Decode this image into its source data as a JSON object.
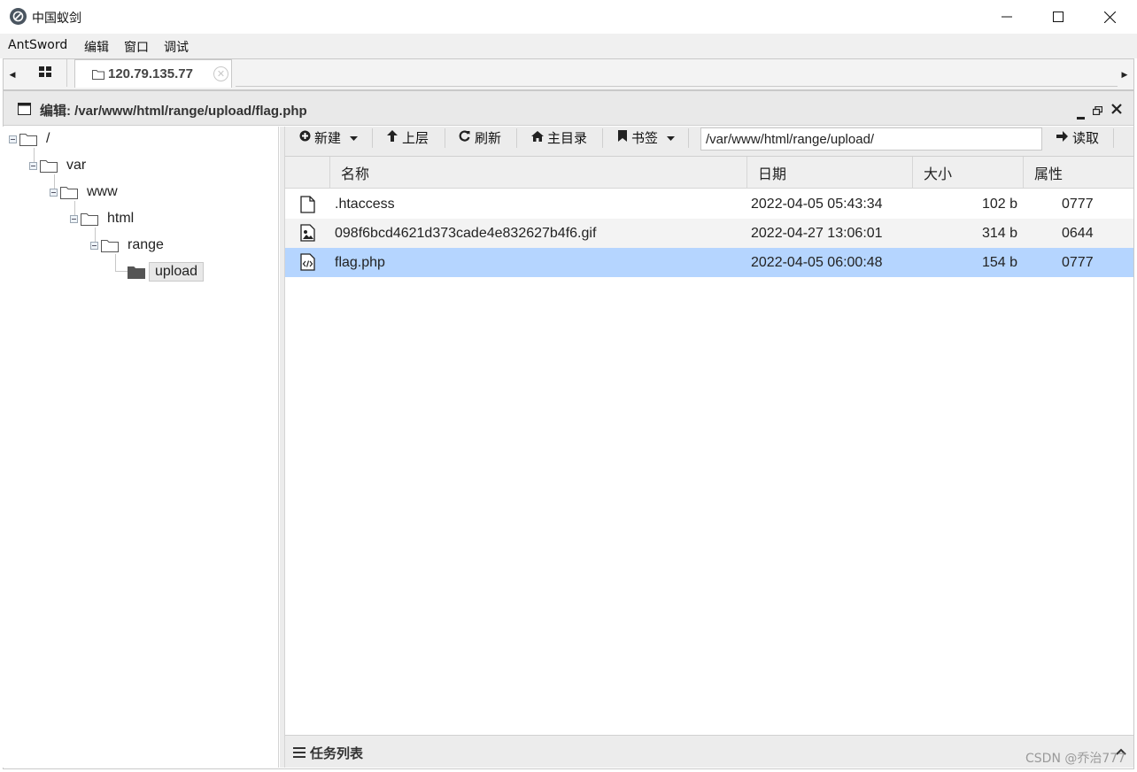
{
  "window": {
    "title": "中国蚁剑"
  },
  "menu": [
    "AntSword",
    "编辑",
    "窗口",
    "调试"
  ],
  "tabs": {
    "host_label": "120.79.135.77"
  },
  "panel": {
    "title": "编辑: /var/www/html/range/upload/flag.php"
  },
  "tree": [
    {
      "label": "/",
      "depth": 0,
      "expanded": true,
      "selected": false
    },
    {
      "label": "var",
      "depth": 1,
      "expanded": true,
      "selected": false
    },
    {
      "label": "www",
      "depth": 2,
      "expanded": true,
      "selected": false
    },
    {
      "label": "html",
      "depth": 3,
      "expanded": true,
      "selected": false
    },
    {
      "label": "range",
      "depth": 4,
      "expanded": true,
      "selected": false
    },
    {
      "label": "upload",
      "depth": 5,
      "expanded": false,
      "selected": true
    }
  ],
  "toolbar": {
    "new_label": "新建",
    "up_label": "上层",
    "refresh_label": "刷新",
    "home_label": "主目录",
    "bookmark_label": "书签",
    "path_value": "/var/www/html/range/upload/",
    "read_label": "读取"
  },
  "grid": {
    "columns": [
      "名称",
      "日期",
      "大小",
      "属性"
    ],
    "rows": [
      {
        "icon": "file-icon",
        "name": ".htaccess",
        "date": "2022-04-05 05:43:34",
        "size": "102 b",
        "attr": "0777",
        "selected": false
      },
      {
        "icon": "image-file-icon",
        "name": "098f6bcd4621d373cade4e832627b4f6.gif",
        "date": "2022-04-27 13:06:01",
        "size": "314 b",
        "attr": "0644",
        "selected": false
      },
      {
        "icon": "code-file-icon",
        "name": "flag.php",
        "date": "2022-04-05 06:00:48",
        "size": "154 b",
        "attr": "0777",
        "selected": true
      }
    ]
  },
  "tasks": {
    "label": "任务列表"
  },
  "watermark": "CSDN @乔治777",
  "colors": {
    "selected_row": "#b5d5ff",
    "alt_row": "#f3f3f3",
    "toolbar_bg": "#ececec"
  }
}
